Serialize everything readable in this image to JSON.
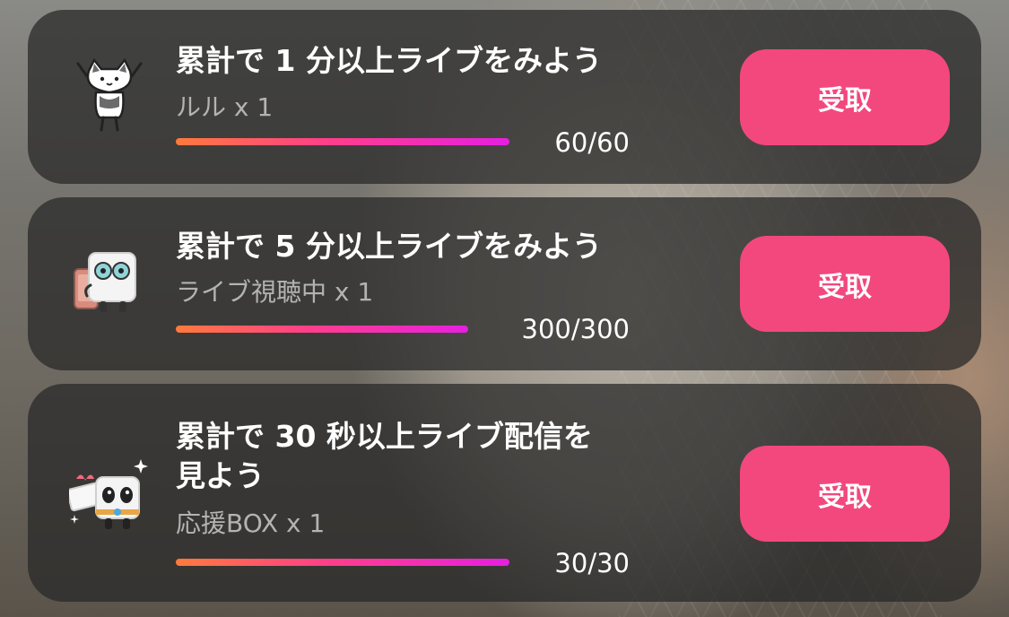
{
  "missions": [
    {
      "title": "累計で 1 分以上ライブをみよう",
      "reward": "ルル x 1",
      "reward_icon": "cat-sticker-icon",
      "progress_text": "60/60",
      "progress_fraction": 1.0,
      "button_label": "受取"
    },
    {
      "title": "累計で 5 分以上ライブをみよう",
      "reward": "ライブ視聴中 x 1",
      "reward_icon": "live-watching-sticker-icon",
      "progress_text": "300/300",
      "progress_fraction": 1.0,
      "button_label": "受取"
    },
    {
      "title": "累計で 30 秒以上ライブ配信を\n見よう",
      "reward": "応援BOX x 1",
      "reward_icon": "cheer-box-sticker-icon",
      "progress_text": "30/30",
      "progress_fraction": 1.0,
      "button_label": "受取"
    }
  ],
  "colors": {
    "card_background": "#282828",
    "button": "#f2487e",
    "progress_start": "#ff7a3c",
    "progress_end": "#e61fe0",
    "reward_text": "#b3b3b3"
  }
}
